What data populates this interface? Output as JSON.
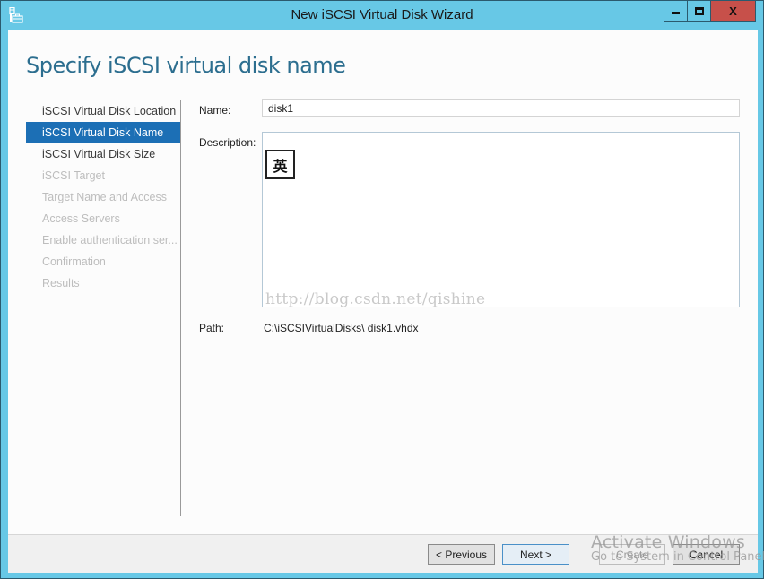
{
  "window": {
    "title": "New iSCSI Virtual Disk Wizard",
    "icon": "server-toolbox-icon",
    "controls": {
      "minimize": "minimize-icon",
      "maximize": "maximize-icon",
      "close_label": "X"
    }
  },
  "page": {
    "title": "Specify iSCSI virtual disk name"
  },
  "steps": [
    {
      "label": "iSCSI Virtual Disk Location",
      "state": "done"
    },
    {
      "label": "iSCSI Virtual Disk Name",
      "state": "active"
    },
    {
      "label": "iSCSI Virtual Disk Size",
      "state": "enabled"
    },
    {
      "label": "iSCSI Target",
      "state": "disabled"
    },
    {
      "label": "Target Name and Access",
      "state": "disabled"
    },
    {
      "label": "Access Servers",
      "state": "disabled"
    },
    {
      "label": "Enable authentication ser...",
      "state": "disabled"
    },
    {
      "label": "Confirmation",
      "state": "disabled"
    },
    {
      "label": "Results",
      "state": "disabled"
    }
  ],
  "form": {
    "name_label": "Name:",
    "name_value": "disk1",
    "description_label": "Description:",
    "description_value": "",
    "ime_indicator": "英",
    "path_label": "Path:",
    "path_value": "C:\\iSCSIVirtualDisks\\ disk1.vhdx"
  },
  "watermark": "http://blog.csdn.net/qishine",
  "buttons": {
    "previous": "< Previous",
    "next": "Next >",
    "create": "Create",
    "cancel": "Cancel"
  },
  "activation_notice": {
    "title": "Activate Windows",
    "subtitle": "Go to System in Control Panel"
  },
  "colors": {
    "chrome": "#67c8e6",
    "accent_selected": "#1c6fb5",
    "title_text": "#2c6e8f",
    "close_button": "#c7504a"
  }
}
